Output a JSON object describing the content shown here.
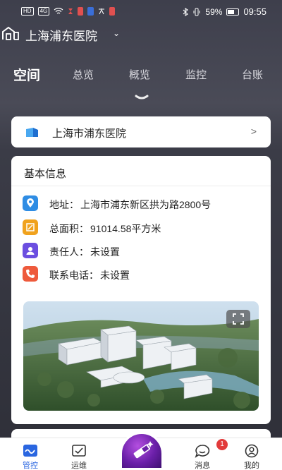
{
  "status_bar": {
    "left_badges": [
      "HD",
      "4G"
    ],
    "battery": "59%",
    "time": "09:55"
  },
  "header": {
    "hospital_name": "上海浦东医院"
  },
  "tabs": [
    {
      "label": "空间",
      "active": true
    },
    {
      "label": "总览",
      "active": false
    },
    {
      "label": "概览",
      "active": false
    },
    {
      "label": "监控",
      "active": false
    },
    {
      "label": "台账",
      "active": false
    }
  ],
  "hospital_card": {
    "name": "上海市浦东医院",
    "arrow": ">"
  },
  "info_card": {
    "title": "基本信息",
    "rows": [
      {
        "label": "地址：",
        "value": "上海市浦东新区拱为路2800号",
        "icon": "location-icon",
        "color": "#2f8de4"
      },
      {
        "label": "总面积：",
        "value": "91014.58平方米",
        "icon": "area-icon",
        "color": "#f0a21d"
      },
      {
        "label": "责任人：",
        "value": "未设置",
        "icon": "person-icon",
        "color": "#6b4ee0"
      },
      {
        "label": "联系电话：",
        "value": "未设置",
        "icon": "phone-icon",
        "color": "#ee5a3c"
      }
    ]
  },
  "bottom_nav": {
    "items": [
      {
        "label": "管控",
        "icon": "control-icon",
        "active": true
      },
      {
        "label": "运维",
        "icon": "maintenance-icon",
        "active": false
      },
      {
        "label": "消息",
        "icon": "message-icon",
        "active": false,
        "badge": "1"
      },
      {
        "label": "我的",
        "icon": "profile-icon",
        "active": false
      }
    ]
  },
  "colors": {
    "accent": "#2a66e0",
    "badge": "#e23b3b"
  }
}
